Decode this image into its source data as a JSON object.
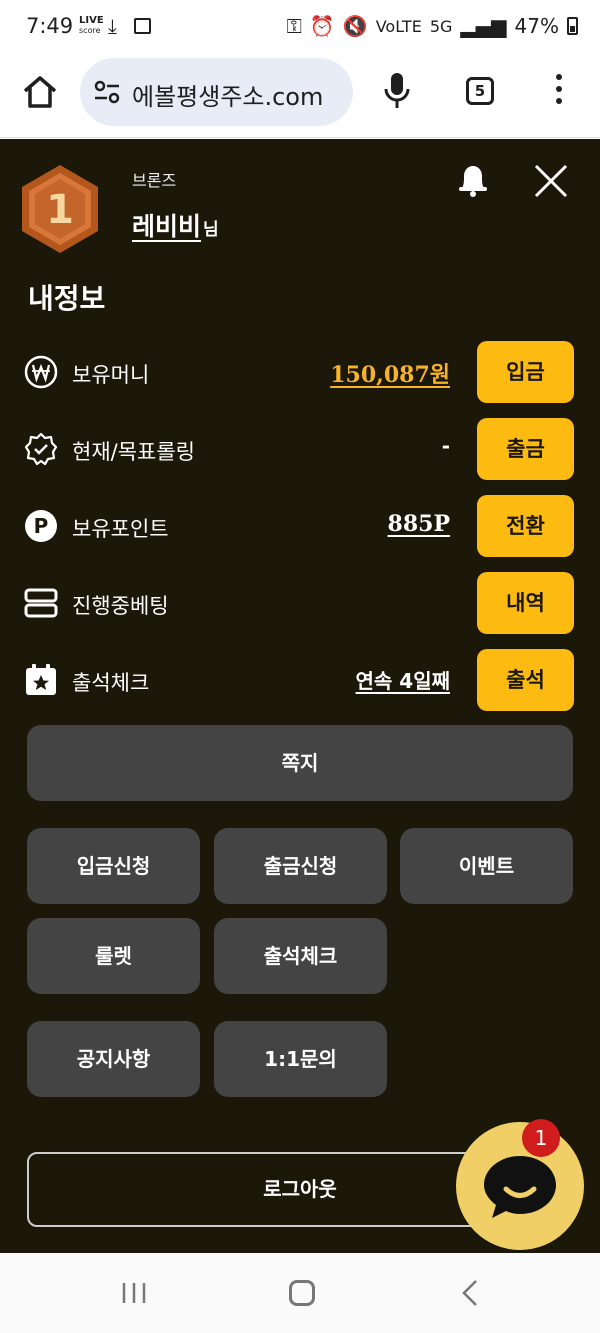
{
  "status_bar": {
    "time": "7:49",
    "live_line1": "LIVE",
    "live_line2": "score",
    "network": "5G",
    "battery": "47%"
  },
  "browser": {
    "url": "에볼평생주소.com",
    "tab_count": "5"
  },
  "profile": {
    "tier_number": "1",
    "tier": "브론즈",
    "username": "레비비",
    "suffix": "님"
  },
  "section_title": "내정보",
  "info_rows": [
    {
      "label": "보유머니",
      "value": "150,087원",
      "action": "입금",
      "icon": "won-icon"
    },
    {
      "label": "현재/목표롤링",
      "value": "-",
      "action": "출금",
      "icon": "verified-badge-icon"
    },
    {
      "label": "보유포인트",
      "value": "885P",
      "action": "전환",
      "icon": "point-icon"
    },
    {
      "label": "진행중베팅",
      "value": "",
      "action": "내역",
      "icon": "betting-list-icon"
    },
    {
      "label": "출석체크",
      "value": "연속 4일째",
      "action": "출석",
      "icon": "calendar-star-icon"
    }
  ],
  "message_button": "쪽지",
  "menu_buttons": [
    "입금신청",
    "출금신청",
    "이벤트",
    "룰렛",
    "출석체크",
    "공지사항",
    "1:1문의"
  ],
  "logout_label": "로그아웃",
  "chat_badge": "1",
  "colors": {
    "panel_bg": "#1b1709",
    "accent": "#fdbb11",
    "money": "#f7b32b",
    "button_bg": "#444444",
    "chat_bg": "#efcf66",
    "badge_red": "#d01c1c"
  }
}
